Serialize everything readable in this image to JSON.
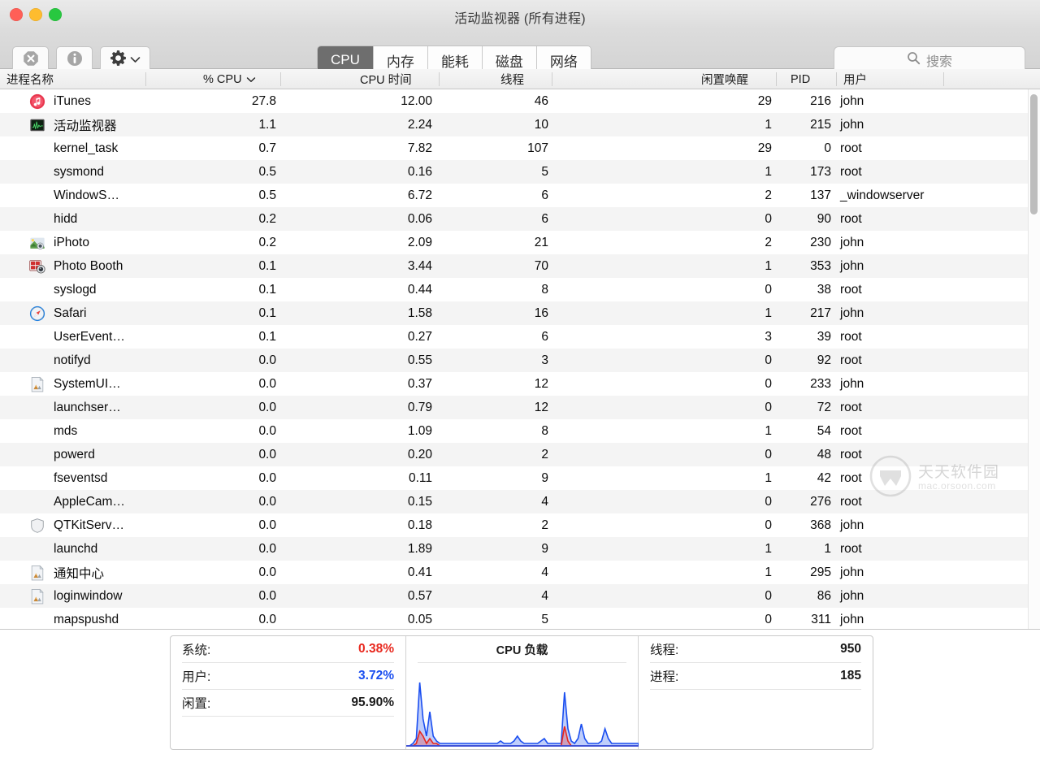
{
  "window": {
    "title": "活动监视器 (所有进程)",
    "traffic_lights": [
      "close",
      "minimize",
      "maximize"
    ]
  },
  "toolbar": {
    "quit_process_label": "stop-process",
    "inspect_label": "inspect-process",
    "gear_label": "view-options",
    "tabs": [
      {
        "label": "CPU",
        "active": true
      },
      {
        "label": "内存",
        "active": false
      },
      {
        "label": "能耗",
        "active": false
      },
      {
        "label": "磁盘",
        "active": false
      },
      {
        "label": "网络",
        "active": false
      }
    ],
    "search": {
      "placeholder": "搜索",
      "value": ""
    }
  },
  "table": {
    "columns": [
      {
        "label": "进程名称",
        "align": "left",
        "sorted": false
      },
      {
        "label": "% CPU",
        "align": "right",
        "sorted": true
      },
      {
        "label": "CPU 时间",
        "align": "right",
        "sorted": false
      },
      {
        "label": "线程",
        "align": "right",
        "sorted": false
      },
      {
        "label": "闲置唤醒",
        "align": "right",
        "sorted": false
      },
      {
        "label": "PID",
        "align": "right",
        "sorted": false
      },
      {
        "label": "用户",
        "align": "left",
        "sorted": false
      }
    ],
    "sort_indicator": "chevron-down",
    "rows": [
      {
        "icon": "itunes",
        "name": "iTunes",
        "cpu": "27.8",
        "cpu_time": "12.00",
        "threads": "46",
        "idle_wake": "29",
        "pid": "216",
        "user": "john"
      },
      {
        "icon": "activity",
        "name": "活动监视器",
        "cpu": "1.1",
        "cpu_time": "2.24",
        "threads": "10",
        "idle_wake": "1",
        "pid": "215",
        "user": "john"
      },
      {
        "icon": "",
        "name": "kernel_task",
        "cpu": "0.7",
        "cpu_time": "7.82",
        "threads": "107",
        "idle_wake": "29",
        "pid": "0",
        "user": "root"
      },
      {
        "icon": "",
        "name": "sysmond",
        "cpu": "0.5",
        "cpu_time": "0.16",
        "threads": "5",
        "idle_wake": "1",
        "pid": "173",
        "user": "root"
      },
      {
        "icon": "",
        "name": "WindowS…",
        "cpu": "0.5",
        "cpu_time": "6.72",
        "threads": "6",
        "idle_wake": "2",
        "pid": "137",
        "user": "_windowserver"
      },
      {
        "icon": "",
        "name": "hidd",
        "cpu": "0.2",
        "cpu_time": "0.06",
        "threads": "6",
        "idle_wake": "0",
        "pid": "90",
        "user": "root"
      },
      {
        "icon": "iphoto",
        "name": "iPhoto",
        "cpu": "0.2",
        "cpu_time": "2.09",
        "threads": "21",
        "idle_wake": "2",
        "pid": "230",
        "user": "john"
      },
      {
        "icon": "photobooth",
        "name": "Photo Booth",
        "cpu": "0.1",
        "cpu_time": "3.44",
        "threads": "70",
        "idle_wake": "1",
        "pid": "353",
        "user": "john"
      },
      {
        "icon": "",
        "name": "syslogd",
        "cpu": "0.1",
        "cpu_time": "0.44",
        "threads": "8",
        "idle_wake": "0",
        "pid": "38",
        "user": "root"
      },
      {
        "icon": "safari",
        "name": "Safari",
        "cpu": "0.1",
        "cpu_time": "1.58",
        "threads": "16",
        "idle_wake": "1",
        "pid": "217",
        "user": "john"
      },
      {
        "icon": "",
        "name": "UserEvent…",
        "cpu": "0.1",
        "cpu_time": "0.27",
        "threads": "6",
        "idle_wake": "3",
        "pid": "39",
        "user": "root"
      },
      {
        "icon": "",
        "name": "notifyd",
        "cpu": "0.0",
        "cpu_time": "0.55",
        "threads": "3",
        "idle_wake": "0",
        "pid": "92",
        "user": "root"
      },
      {
        "icon": "generic",
        "name": "SystemUI…",
        "cpu": "0.0",
        "cpu_time": "0.37",
        "threads": "12",
        "idle_wake": "0",
        "pid": "233",
        "user": "john"
      },
      {
        "icon": "",
        "name": "launchser…",
        "cpu": "0.0",
        "cpu_time": "0.79",
        "threads": "12",
        "idle_wake": "0",
        "pid": "72",
        "user": "root"
      },
      {
        "icon": "",
        "name": "mds",
        "cpu": "0.0",
        "cpu_time": "1.09",
        "threads": "8",
        "idle_wake": "1",
        "pid": "54",
        "user": "root"
      },
      {
        "icon": "",
        "name": "powerd",
        "cpu": "0.0",
        "cpu_time": "0.20",
        "threads": "2",
        "idle_wake": "0",
        "pid": "48",
        "user": "root"
      },
      {
        "icon": "",
        "name": "fseventsd",
        "cpu": "0.0",
        "cpu_time": "0.11",
        "threads": "9",
        "idle_wake": "1",
        "pid": "42",
        "user": "root"
      },
      {
        "icon": "",
        "name": "AppleCam…",
        "cpu": "0.0",
        "cpu_time": "0.15",
        "threads": "4",
        "idle_wake": "0",
        "pid": "276",
        "user": "root"
      },
      {
        "icon": "shield",
        "name": "QTKitServ…",
        "cpu": "0.0",
        "cpu_time": "0.18",
        "threads": "2",
        "idle_wake": "0",
        "pid": "368",
        "user": "john"
      },
      {
        "icon": "",
        "name": "launchd",
        "cpu": "0.0",
        "cpu_time": "1.89",
        "threads": "9",
        "idle_wake": "1",
        "pid": "1",
        "user": "root"
      },
      {
        "icon": "generic",
        "name": "通知中心",
        "cpu": "0.0",
        "cpu_time": "0.41",
        "threads": "4",
        "idle_wake": "1",
        "pid": "295",
        "user": "john"
      },
      {
        "icon": "generic",
        "name": "loginwindow",
        "cpu": "0.0",
        "cpu_time": "0.57",
        "threads": "4",
        "idle_wake": "0",
        "pid": "86",
        "user": "john"
      },
      {
        "icon": "",
        "name": "mapspushd",
        "cpu": "0.0",
        "cpu_time": "0.05",
        "threads": "5",
        "idle_wake": "0",
        "pid": "311",
        "user": "john"
      }
    ]
  },
  "footer": {
    "left_stats": [
      {
        "label": "系统:",
        "value": "0.38%",
        "color": "#e8281e"
      },
      {
        "label": "用户:",
        "value": "3.72%",
        "color": "#1a4ef0"
      },
      {
        "label": "闲置:",
        "value": "95.90%",
        "color": "#1a1a1a"
      }
    ],
    "graph_title": "CPU 负载",
    "right_stats": [
      {
        "label": "线程:",
        "value": "950"
      },
      {
        "label": "进程:",
        "value": "185"
      }
    ]
  },
  "watermark": {
    "cn": "天天软件园",
    "en": "mac.orsoon.com"
  },
  "chart_data": {
    "type": "area",
    "title": "CPU 负载",
    "xlabel": "",
    "ylabel": "",
    "ylim": [
      0,
      100
    ],
    "grid": false,
    "legend": "none",
    "series": [
      {
        "name": "用户",
        "color": "#1a4ef0",
        "values": [
          0,
          0,
          1,
          3,
          26,
          11,
          4,
          14,
          4,
          2,
          1,
          1,
          1,
          1,
          1,
          1,
          1,
          1,
          1,
          1,
          1,
          1,
          1,
          1,
          1,
          1,
          1,
          1,
          2,
          1,
          1,
          1,
          2,
          4,
          2,
          1,
          1,
          1,
          1,
          1,
          2,
          3,
          1,
          1,
          1,
          1,
          1,
          22,
          7,
          2,
          1,
          3,
          9,
          3,
          1,
          1,
          1,
          1,
          2,
          7,
          3,
          1,
          1,
          1,
          1,
          1,
          1,
          1,
          1,
          1
        ]
      },
      {
        "name": "系统",
        "color": "#e8281e",
        "values": [
          0,
          0,
          0,
          1,
          6,
          4,
          1,
          3,
          1,
          1,
          0,
          0,
          0,
          0,
          0,
          0,
          0,
          0,
          0,
          0,
          0,
          0,
          0,
          0,
          0,
          0,
          0,
          0,
          0,
          0,
          0,
          0,
          0,
          0,
          0,
          0,
          0,
          0,
          0,
          0,
          0,
          0,
          0,
          0,
          0,
          0,
          0,
          8,
          2,
          0,
          0,
          0,
          0,
          0,
          0,
          0,
          0,
          0,
          0,
          0,
          0,
          0,
          0,
          0,
          0,
          0,
          0,
          0,
          0,
          0
        ]
      }
    ]
  }
}
